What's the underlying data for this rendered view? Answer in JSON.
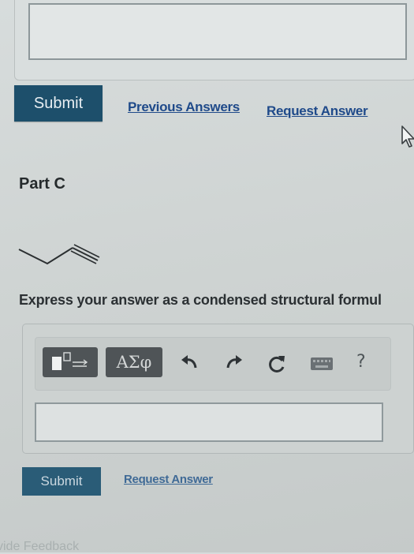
{
  "top": {
    "answer_value": ""
  },
  "actions_part_b": {
    "submit_label": "Submit",
    "previous_answers_label": "Previous Answers",
    "request_answer_label": "Request Answer"
  },
  "part_c": {
    "title": "Part C",
    "instruction": "Express your answer as a condensed structural formul",
    "toolbar": {
      "templates_icon": "templates-icon",
      "symbols_label": "ΑΣφ",
      "undo_icon": "undo-icon",
      "redo_icon": "redo-icon",
      "reset_icon": "reset-icon",
      "keyboard_icon": "keyboard-icon",
      "help_label": "?"
    },
    "answer_value": "",
    "submit_label": "Submit",
    "request_answer_label": "Request Answer"
  },
  "footer": {
    "text": "vide Feedback"
  },
  "colors": {
    "submit_bg": "#1d4f6b",
    "link": "#1f4a8a",
    "toolbar_button_bg": "#4f5457",
    "background": "#d3d8d7"
  }
}
